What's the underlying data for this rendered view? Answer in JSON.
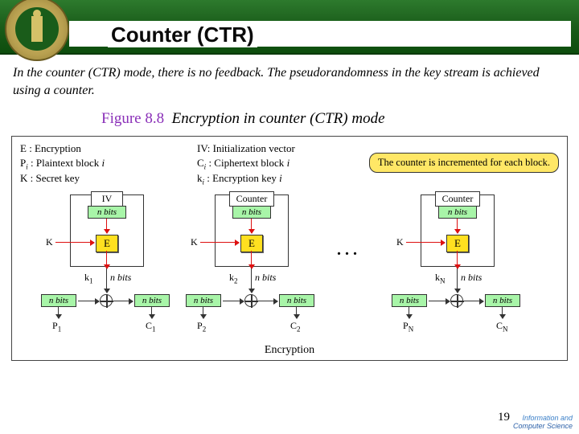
{
  "header": {
    "title": "Counter (CTR)"
  },
  "intro": "In the counter (CTR) mode, there is no feedback. The pseudorandomness in the key stream is achieved using a counter.",
  "figure": {
    "number": "Figure 8.8",
    "caption": "Encryption in counter (CTR) mode"
  },
  "legend": {
    "E": "E : Encryption",
    "P": "P",
    "Pi_desc": " : Plaintext block ",
    "K": "K : Secret key",
    "IV": "IV: Initialization vector",
    "C": "C",
    "Ci_desc": " : Ciphertext block ",
    "ki": "k",
    "ki_desc": " : Encryption key ",
    "i": "i"
  },
  "note": "The counter is incremented for each block.",
  "labels": {
    "IV": "IV",
    "Counter": "Counter",
    "nbits": "n bits",
    "n_bits_sp": "n bits",
    "E": "E",
    "K": "K",
    "k1": "k",
    "k2": "k",
    "kN": "k",
    "s1": "1",
    "s2": "2",
    "sN": "N",
    "P1": "P",
    "P2": "P",
    "PN": "P",
    "C1": "C",
    "C2": "C",
    "CN": "C",
    "dots": ". . .",
    "Encryption": "Encryption"
  },
  "page": "19",
  "footer": {
    "line1": "Information and",
    "line2": "Computer Science"
  }
}
